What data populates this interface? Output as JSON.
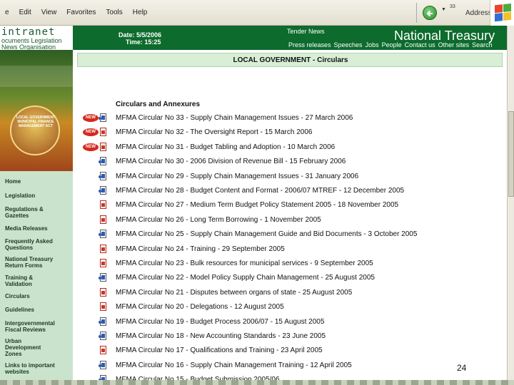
{
  "menu": [
    "e",
    "Edit",
    "View",
    "Favorites",
    "Tools",
    "Help"
  ],
  "toolbar": {
    "number": "33",
    "address_label": "Address"
  },
  "left_header": {
    "title": "intranet",
    "line1": "ocuments Legislation",
    "line2": "News Organisation"
  },
  "banner_text": "LOCAL GOVERNMENT MUNICIPAL FINANCE MANAGEMENT ACT",
  "header": {
    "date": "Date: 5/5/2006",
    "time": "Time: 15:25",
    "tender": "Tender News",
    "brand": "National Treasury",
    "nav": [
      "Press releases",
      "Speeches",
      "Jobs",
      "People",
      "Contact us",
      "Other sites",
      "Search"
    ]
  },
  "sidebar": {
    "items": [
      "Home",
      "Legislation",
      "Regulations & Gazettes",
      "Media Releases",
      "Frequently Asked Questions",
      "National Treasury Return Forms",
      "Training & Validation",
      "Circulars",
      "Guidelines",
      "Intergovernmental Fiscal Reviews",
      "Urban Development Zones",
      "Links to important websites"
    ]
  },
  "content": {
    "page_title": "LOCAL GOVERNMENT - Circulars",
    "section_heading": "Circulars and Annexures",
    "new_badge": "NEW",
    "circulars": [
      {
        "text": "MFMA Circular No 33 - Supply Chain Management Issues - 27 March 2006",
        "new": true,
        "icon": "word"
      },
      {
        "text": "MFMA Circular No 32 - The Oversight Report - 15 March 2006",
        "new": true,
        "icon": "pdf"
      },
      {
        "text": "MFMA Circular No 31 - Budget Tabling and Adoption - 10 March 2006",
        "new": true,
        "icon": "pdf"
      },
      {
        "text": "MFMA Circular No 30 - 2006 Division of Revenue Bill - 15 February 2006",
        "new": false,
        "icon": "word"
      },
      {
        "text": "MFMA Circular No 29 - Supply Chain Management Issues - 31 January 2006",
        "new": false,
        "icon": "word"
      },
      {
        "text": "MFMA Circular No 28 - Budget Content and Format - 2006/07 MTREF - 12 December 2005",
        "new": false,
        "icon": "word"
      },
      {
        "text": "MFMA Circular No 27 - Medium Term Budget Policy Statement 2005 - 18 November 2005",
        "new": false,
        "icon": "pdf"
      },
      {
        "text": "MFMA Circular No 26 - Long Term Borrowing - 1 November 2005",
        "new": false,
        "icon": "pdf"
      },
      {
        "text": "MFMA Circular No 25 - Supply Chain Management Guide and Bid Documents - 3 October 2005",
        "new": false,
        "icon": "word"
      },
      {
        "text": "MFMA Circular No 24 - Training - 29 September 2005",
        "new": false,
        "icon": "pdf"
      },
      {
        "text": "MFMA Circular No 23 - Bulk resources for municipal services - 9 September 2005",
        "new": false,
        "icon": "pdf"
      },
      {
        "text": "MFMA Circular No 22 - Model Policy Supply Chain Management - 25 August 2005",
        "new": false,
        "icon": "word"
      },
      {
        "text": "MFMA Circular No 21 - Disputes between organs of state - 25 August 2005",
        "new": false,
        "icon": "pdf"
      },
      {
        "text": "MFMA Circular No 20 - Delegations - 12 August 2005",
        "new": false,
        "icon": "pdf"
      },
      {
        "text": "MFMA Circular No 19 - Budget Process 2006/07 - 15 August 2005",
        "new": false,
        "icon": "word"
      },
      {
        "text": "MFMA Circular No 18 - New Accounting Standards - 23 June 2005",
        "new": false,
        "icon": "word"
      },
      {
        "text": "MFMA Circular No 17 - Qualifications and Training - 23 April 2005",
        "new": false,
        "icon": "pdf"
      },
      {
        "text": "MFMA Circular No 16 - Supply Chain Management Training - 12 April 2005",
        "new": false,
        "icon": "word"
      },
      {
        "text": "MFMA Circular No 15 - Budget Submission 2005/06",
        "new": false,
        "icon": "word"
      }
    ]
  },
  "slide_number": "24"
}
